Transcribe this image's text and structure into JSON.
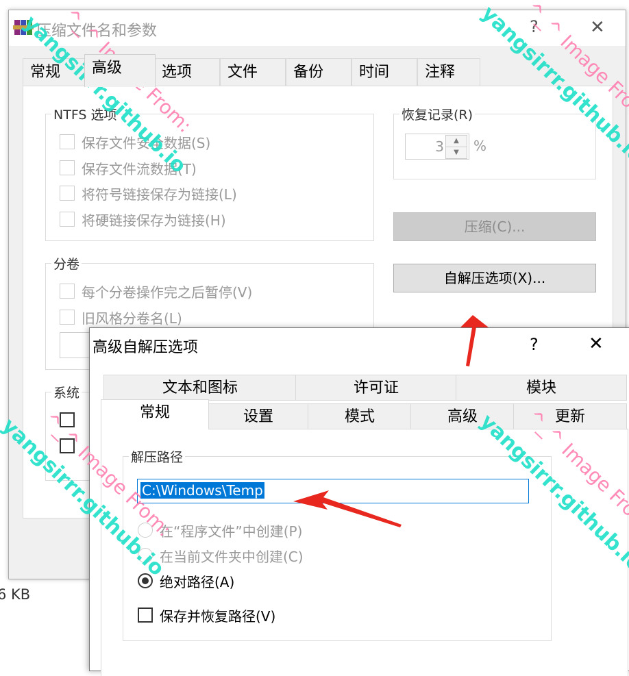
{
  "main_window": {
    "title": "压缩文件名和参数",
    "help_glyph": "?",
    "close_glyph": "✕",
    "tabs": [
      {
        "label": "常规"
      },
      {
        "label": "高级"
      },
      {
        "label": "选项"
      },
      {
        "label": "文件"
      },
      {
        "label": "备份"
      },
      {
        "label": "时间"
      },
      {
        "label": "注释"
      }
    ],
    "ntfs_group": {
      "label": "NTFS 选项",
      "options": [
        {
          "label": "保存文件安全数据(S)"
        },
        {
          "label": "保存文件流数据(T)"
        },
        {
          "label": "将符号链接保存为链接(L)"
        },
        {
          "label": "将硬链接保存为链接(H)"
        }
      ]
    },
    "recovery_group": {
      "label": "恢复记录(R)",
      "value": "3",
      "unit": "%"
    },
    "compress_button": "压缩(C)...",
    "sfx_button": "自解压选项(X)...",
    "volume_group": {
      "label": "分卷",
      "options": [
        {
          "label": "每个分卷操作完之后暂停(V)"
        },
        {
          "label": "旧风格分卷名(L)"
        }
      ]
    },
    "system_group": {
      "label": "系统"
    },
    "status_size": "6 KB"
  },
  "sfx_dialog": {
    "title": "高级自解压选项",
    "help_glyph": "?",
    "close_glyph": "✕",
    "tabs_row1": [
      {
        "label": "文本和图标"
      },
      {
        "label": "许可证"
      },
      {
        "label": "模块"
      }
    ],
    "tabs_row2": [
      {
        "label": "常规"
      },
      {
        "label": "设置"
      },
      {
        "label": "模式"
      },
      {
        "label": "高级"
      },
      {
        "label": "更新"
      }
    ],
    "path_group": {
      "label": "解压路径",
      "path_value": "C:\\Windows\\Temp",
      "radios": [
        {
          "label": "在“程序文件”中创建(P)",
          "checked": false
        },
        {
          "label": "在当前文件夹中创建(C)",
          "checked": false
        },
        {
          "label": "绝对路径(A)",
          "checked": true
        }
      ],
      "save_restore_label": "保存并恢复路径(V)"
    }
  },
  "watermarks": {
    "site": "yangsirrr.github.io",
    "from": "^_^ Image From:"
  },
  "colors": {
    "watermark_site": "#1fe0c8",
    "watermark_from": "#ff7fb0",
    "arrow": "#e8281e",
    "selection": "#0078d7"
  }
}
